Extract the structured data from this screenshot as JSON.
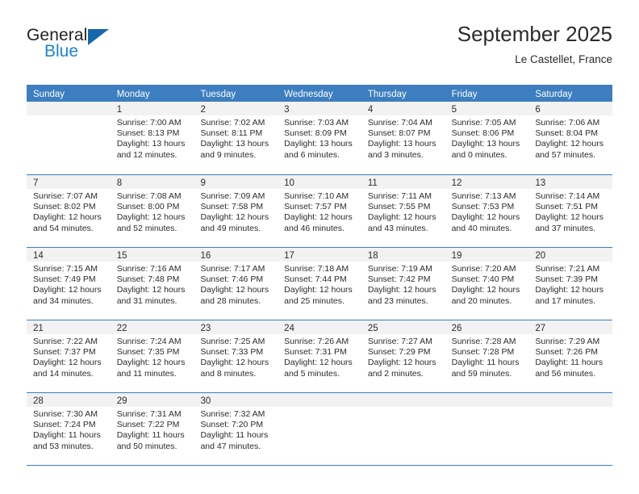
{
  "brand": {
    "word_one": "General",
    "word_two": "Blue",
    "triangle_color": "#1668ae",
    "blue_color": "#1c83d4"
  },
  "header": {
    "title": "September 2025",
    "subtitle": "Le Castellet, France"
  },
  "calendar": {
    "header_bg": "#3c7ebf",
    "daynum_bg": "#f2f2f2",
    "weekdays": [
      "Sunday",
      "Monday",
      "Tuesday",
      "Wednesday",
      "Thursday",
      "Friday",
      "Saturday"
    ],
    "weeks": [
      [
        {
          "day": "",
          "sunrise": "",
          "sunset": "",
          "daylight_line1": "",
          "daylight_line2": ""
        },
        {
          "day": "1",
          "sunrise": "Sunrise: 7:00 AM",
          "sunset": "Sunset: 8:13 PM",
          "daylight_line1": "Daylight: 13 hours",
          "daylight_line2": "and 12 minutes."
        },
        {
          "day": "2",
          "sunrise": "Sunrise: 7:02 AM",
          "sunset": "Sunset: 8:11 PM",
          "daylight_line1": "Daylight: 13 hours",
          "daylight_line2": "and 9 minutes."
        },
        {
          "day": "3",
          "sunrise": "Sunrise: 7:03 AM",
          "sunset": "Sunset: 8:09 PM",
          "daylight_line1": "Daylight: 13 hours",
          "daylight_line2": "and 6 minutes."
        },
        {
          "day": "4",
          "sunrise": "Sunrise: 7:04 AM",
          "sunset": "Sunset: 8:07 PM",
          "daylight_line1": "Daylight: 13 hours",
          "daylight_line2": "and 3 minutes."
        },
        {
          "day": "5",
          "sunrise": "Sunrise: 7:05 AM",
          "sunset": "Sunset: 8:06 PM",
          "daylight_line1": "Daylight: 13 hours",
          "daylight_line2": "and 0 minutes."
        },
        {
          "day": "6",
          "sunrise": "Sunrise: 7:06 AM",
          "sunset": "Sunset: 8:04 PM",
          "daylight_line1": "Daylight: 12 hours",
          "daylight_line2": "and 57 minutes."
        }
      ],
      [
        {
          "day": "7",
          "sunrise": "Sunrise: 7:07 AM",
          "sunset": "Sunset: 8:02 PM",
          "daylight_line1": "Daylight: 12 hours",
          "daylight_line2": "and 54 minutes."
        },
        {
          "day": "8",
          "sunrise": "Sunrise: 7:08 AM",
          "sunset": "Sunset: 8:00 PM",
          "daylight_line1": "Daylight: 12 hours",
          "daylight_line2": "and 52 minutes."
        },
        {
          "day": "9",
          "sunrise": "Sunrise: 7:09 AM",
          "sunset": "Sunset: 7:58 PM",
          "daylight_line1": "Daylight: 12 hours",
          "daylight_line2": "and 49 minutes."
        },
        {
          "day": "10",
          "sunrise": "Sunrise: 7:10 AM",
          "sunset": "Sunset: 7:57 PM",
          "daylight_line1": "Daylight: 12 hours",
          "daylight_line2": "and 46 minutes."
        },
        {
          "day": "11",
          "sunrise": "Sunrise: 7:11 AM",
          "sunset": "Sunset: 7:55 PM",
          "daylight_line1": "Daylight: 12 hours",
          "daylight_line2": "and 43 minutes."
        },
        {
          "day": "12",
          "sunrise": "Sunrise: 7:13 AM",
          "sunset": "Sunset: 7:53 PM",
          "daylight_line1": "Daylight: 12 hours",
          "daylight_line2": "and 40 minutes."
        },
        {
          "day": "13",
          "sunrise": "Sunrise: 7:14 AM",
          "sunset": "Sunset: 7:51 PM",
          "daylight_line1": "Daylight: 12 hours",
          "daylight_line2": "and 37 minutes."
        }
      ],
      [
        {
          "day": "14",
          "sunrise": "Sunrise: 7:15 AM",
          "sunset": "Sunset: 7:49 PM",
          "daylight_line1": "Daylight: 12 hours",
          "daylight_line2": "and 34 minutes."
        },
        {
          "day": "15",
          "sunrise": "Sunrise: 7:16 AM",
          "sunset": "Sunset: 7:48 PM",
          "daylight_line1": "Daylight: 12 hours",
          "daylight_line2": "and 31 minutes."
        },
        {
          "day": "16",
          "sunrise": "Sunrise: 7:17 AM",
          "sunset": "Sunset: 7:46 PM",
          "daylight_line1": "Daylight: 12 hours",
          "daylight_line2": "and 28 minutes."
        },
        {
          "day": "17",
          "sunrise": "Sunrise: 7:18 AM",
          "sunset": "Sunset: 7:44 PM",
          "daylight_line1": "Daylight: 12 hours",
          "daylight_line2": "and 25 minutes."
        },
        {
          "day": "18",
          "sunrise": "Sunrise: 7:19 AM",
          "sunset": "Sunset: 7:42 PM",
          "daylight_line1": "Daylight: 12 hours",
          "daylight_line2": "and 23 minutes."
        },
        {
          "day": "19",
          "sunrise": "Sunrise: 7:20 AM",
          "sunset": "Sunset: 7:40 PM",
          "daylight_line1": "Daylight: 12 hours",
          "daylight_line2": "and 20 minutes."
        },
        {
          "day": "20",
          "sunrise": "Sunrise: 7:21 AM",
          "sunset": "Sunset: 7:39 PM",
          "daylight_line1": "Daylight: 12 hours",
          "daylight_line2": "and 17 minutes."
        }
      ],
      [
        {
          "day": "21",
          "sunrise": "Sunrise: 7:22 AM",
          "sunset": "Sunset: 7:37 PM",
          "daylight_line1": "Daylight: 12 hours",
          "daylight_line2": "and 14 minutes."
        },
        {
          "day": "22",
          "sunrise": "Sunrise: 7:24 AM",
          "sunset": "Sunset: 7:35 PM",
          "daylight_line1": "Daylight: 12 hours",
          "daylight_line2": "and 11 minutes."
        },
        {
          "day": "23",
          "sunrise": "Sunrise: 7:25 AM",
          "sunset": "Sunset: 7:33 PM",
          "daylight_line1": "Daylight: 12 hours",
          "daylight_line2": "and 8 minutes."
        },
        {
          "day": "24",
          "sunrise": "Sunrise: 7:26 AM",
          "sunset": "Sunset: 7:31 PM",
          "daylight_line1": "Daylight: 12 hours",
          "daylight_line2": "and 5 minutes."
        },
        {
          "day": "25",
          "sunrise": "Sunrise: 7:27 AM",
          "sunset": "Sunset: 7:29 PM",
          "daylight_line1": "Daylight: 12 hours",
          "daylight_line2": "and 2 minutes."
        },
        {
          "day": "26",
          "sunrise": "Sunrise: 7:28 AM",
          "sunset": "Sunset: 7:28 PM",
          "daylight_line1": "Daylight: 11 hours",
          "daylight_line2": "and 59 minutes."
        },
        {
          "day": "27",
          "sunrise": "Sunrise: 7:29 AM",
          "sunset": "Sunset: 7:26 PM",
          "daylight_line1": "Daylight: 11 hours",
          "daylight_line2": "and 56 minutes."
        }
      ],
      [
        {
          "day": "28",
          "sunrise": "Sunrise: 7:30 AM",
          "sunset": "Sunset: 7:24 PM",
          "daylight_line1": "Daylight: 11 hours",
          "daylight_line2": "and 53 minutes."
        },
        {
          "day": "29",
          "sunrise": "Sunrise: 7:31 AM",
          "sunset": "Sunset: 7:22 PM",
          "daylight_line1": "Daylight: 11 hours",
          "daylight_line2": "and 50 minutes."
        },
        {
          "day": "30",
          "sunrise": "Sunrise: 7:32 AM",
          "sunset": "Sunset: 7:20 PM",
          "daylight_line1": "Daylight: 11 hours",
          "daylight_line2": "and 47 minutes."
        },
        {
          "day": "",
          "sunrise": "",
          "sunset": "",
          "daylight_line1": "",
          "daylight_line2": ""
        },
        {
          "day": "",
          "sunrise": "",
          "sunset": "",
          "daylight_line1": "",
          "daylight_line2": ""
        },
        {
          "day": "",
          "sunrise": "",
          "sunset": "",
          "daylight_line1": "",
          "daylight_line2": ""
        },
        {
          "day": "",
          "sunrise": "",
          "sunset": "",
          "daylight_line1": "",
          "daylight_line2": ""
        }
      ]
    ]
  }
}
